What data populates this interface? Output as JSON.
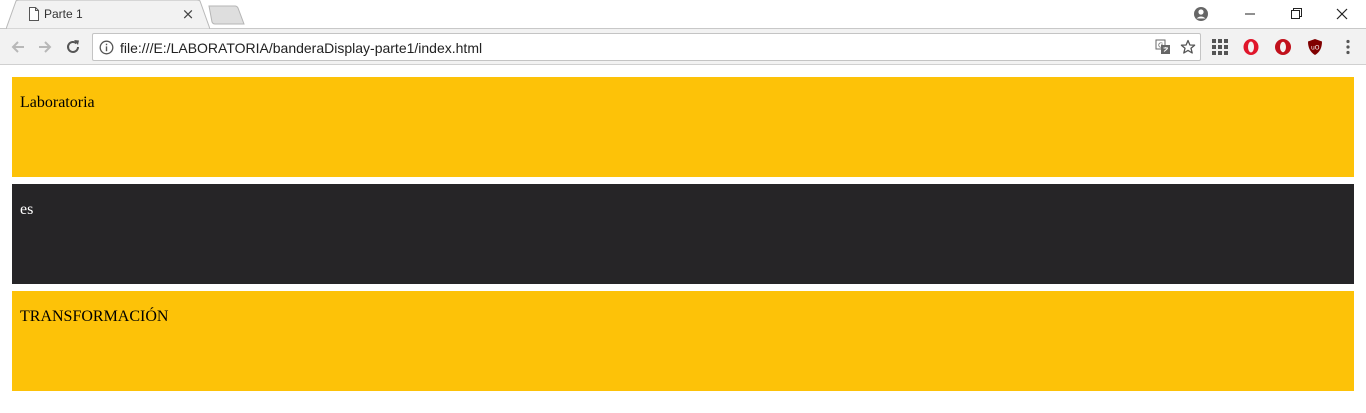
{
  "browser": {
    "tab": {
      "title": "Parte 1",
      "close_glyph": "×"
    },
    "icons": {
      "tab": "file-icon",
      "profile": "profile-icon",
      "back": "back-arrow-icon",
      "forward": "forward-arrow-icon",
      "reload": "reload-icon",
      "info": "info-icon",
      "translate": "translate-icon",
      "bookmark": "star-icon",
      "apps": "apps-grid-icon",
      "ext1": "opera-icon",
      "ext2": "opera-icon",
      "ext3": "ublock-origin-icon",
      "menu": "kebab-menu-icon",
      "minimize": "minimize-icon",
      "restore": "restore-icon",
      "close": "close-icon"
    },
    "address_bar": {
      "url": "file:///E:/LABORATORIA/banderaDisplay-parte1/index.html"
    }
  },
  "page": {
    "bands": [
      {
        "text": "Laboratoria",
        "background": "#fdc208",
        "color": "#000000"
      },
      {
        "text": "es",
        "background": "#262527",
        "color": "#ffffff"
      },
      {
        "text": "TRANSFORMACIÓN",
        "background": "#fdc208",
        "color": "#000000"
      }
    ]
  }
}
